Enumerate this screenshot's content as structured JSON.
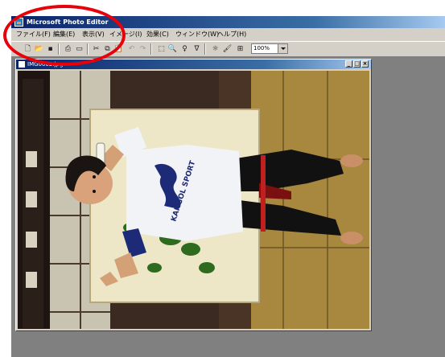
{
  "app": {
    "title": "Microsoft Photo Editor",
    "menu": [
      {
        "label": "ファイル(F)"
      },
      {
        "label": "編集(E)"
      },
      {
        "label": "表示(V)"
      },
      {
        "label": "イメージ(I)"
      },
      {
        "label": "効果(C)"
      },
      {
        "label": "ウィンドウ(W)"
      },
      {
        "label": "ヘルプ(H)"
      }
    ],
    "toolbar": {
      "zoom_value": "100%"
    }
  },
  "document": {
    "filename": "IMG0002.jpg",
    "buttons": {
      "minimize": "_",
      "maximize": "□",
      "close": "×"
    }
  },
  "photo": {
    "shirt_text": "KANGOL SPORT"
  },
  "colors": {
    "highlight": "#e8000a",
    "titlebar": "#0a246a",
    "workspace": "#808080"
  }
}
